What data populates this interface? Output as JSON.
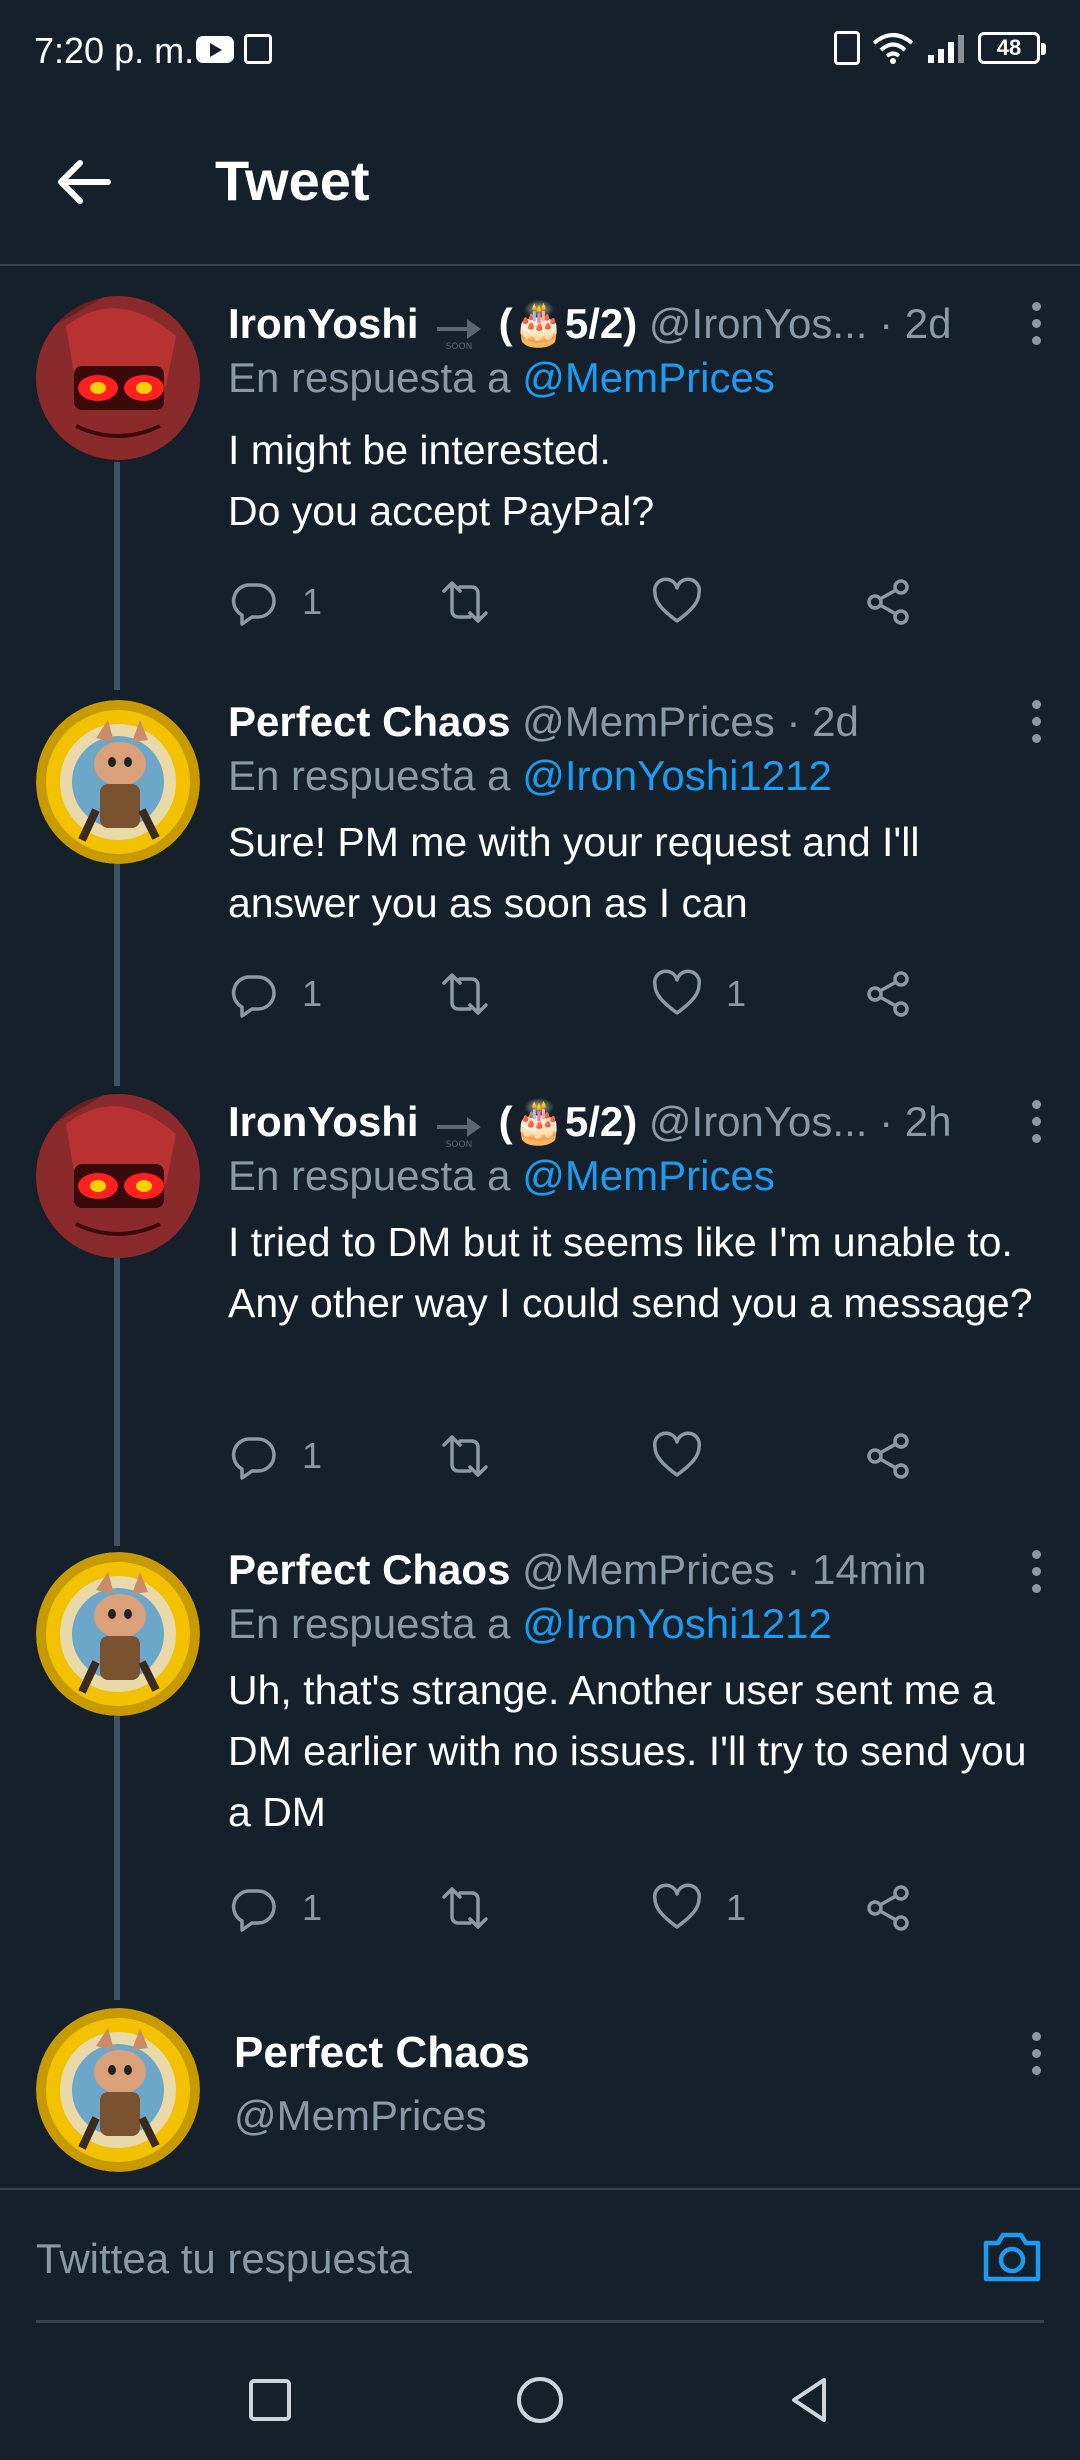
{
  "status_bar": {
    "time": "7:20 p. m.",
    "battery": "48"
  },
  "header": {
    "title": "Tweet"
  },
  "tweets": [
    {
      "name": "IronYoshi",
      "badge": "(🎂5/2)",
      "handle": "@IronYos...",
      "time": "· 2d",
      "reply_prefix": "En respuesta a ",
      "reply_to": "@MemPrices",
      "text": "I might be interested.\nDo you accept PayPal?",
      "replies": "1",
      "likes": ""
    },
    {
      "name": "Perfect Chaos",
      "badge": "",
      "handle": "@MemPrices",
      "time": "· 2d",
      "reply_prefix": "En respuesta a ",
      "reply_to": "@IronYoshi1212",
      "text": "Sure! PM me with your request and I'll answer you as soon as I can",
      "replies": "1",
      "likes": "1"
    },
    {
      "name": "IronYoshi",
      "badge": "(🎂5/2)",
      "handle": "@IronYos...",
      "time": "· 2h",
      "reply_prefix": "En respuesta a ",
      "reply_to": "@MemPrices",
      "text": "I tried to DM but it seems like I'm unable to. Any other way I could send you a message?",
      "replies": "1",
      "likes": ""
    },
    {
      "name": "Perfect Chaos",
      "badge": "",
      "handle": "@MemPrices",
      "time": "· 14min",
      "reply_prefix": "En respuesta a ",
      "reply_to": "@IronYoshi1212",
      "text": "Uh, that's strange. Another user sent me a DM earlier with no issues. I'll try to send you a DM",
      "replies": "1",
      "likes": "1"
    }
  ],
  "soon_label": "SOON",
  "self_card": {
    "name": "Perfect Chaos",
    "handle": "@MemPrices"
  },
  "composer": {
    "placeholder": "Twittea tu respuesta"
  },
  "colors": {
    "background": "#15202b",
    "link": "#1d9bf0",
    "muted": "#8b98a5",
    "divider": "#38444d"
  },
  "icons": [
    "back-arrow-icon",
    "more-icon",
    "reply-icon",
    "retweet-icon",
    "like-icon",
    "share-icon",
    "camera-icon",
    "recent-apps-icon",
    "home-icon",
    "back-icon"
  ]
}
